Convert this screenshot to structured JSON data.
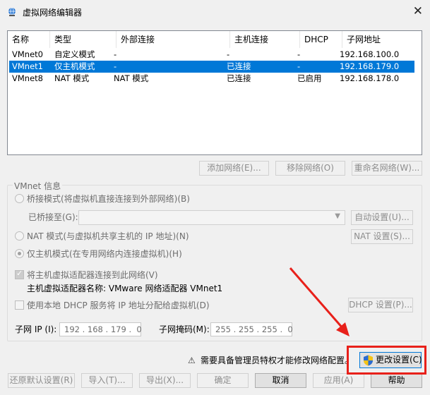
{
  "window": {
    "title": "虚拟网络编辑器",
    "close_glyph": "✕"
  },
  "network_list": {
    "columns": [
      "名称",
      "类型",
      "外部连接",
      "主机连接",
      "DHCP",
      "子网地址"
    ],
    "rows": [
      {
        "name": "VMnet0",
        "type": "自定义模式",
        "external": "-",
        "host": "-",
        "dhcp": "-",
        "subnet": "192.168.100.0",
        "selected": false
      },
      {
        "name": "VMnet1",
        "type": "仅主机模式",
        "external": "-",
        "host": "已连接",
        "dhcp": "-",
        "subnet": "192.168.179.0",
        "selected": true
      },
      {
        "name": "VMnet8",
        "type": "NAT 模式",
        "external": "NAT 模式",
        "host": "已连接",
        "dhcp": "已启用",
        "subnet": "192.168.178.0",
        "selected": false
      }
    ]
  },
  "list_buttons": {
    "add": "添加网络(E)...",
    "remove": "移除网络(O)",
    "rename": "重命名网络(W)..."
  },
  "vmnet_info": {
    "title": "VMnet 信息",
    "bridged_label": "桥接模式(将虚拟机直接连接到外部网络)(B)",
    "bridged_to_label": "已桥接至(G):",
    "bridged_to_value": "",
    "auto_settings_button": "自动设置(U)...",
    "nat_label": "NAT 模式(与虚拟机共享主机的 IP 地址)(N)",
    "nat_settings_button": "NAT 设置(S)...",
    "host_only_label": "仅主机模式(在专用网络内连接虚拟机)(H)",
    "selected_mode": "host_only",
    "connect_adapter_label": "将主机虚拟适配器连接到此网络(V)",
    "connect_adapter_checked": true,
    "adapter_name_label": "主机虚拟适配器名称: VMware 网络适配器 VMnet1",
    "use_dhcp_label": "使用本地 DHCP 服务将 IP 地址分配给虚拟机(D)",
    "use_dhcp_checked": false,
    "dhcp_settings_button": "DHCP 设置(P)...",
    "subnet_ip_label": "子网 IP (I):",
    "subnet_ip_value": "192 . 168 . 179 .  0",
    "subnet_mask_label": "子网掩码(M):",
    "subnet_mask_value": "255 . 255 . 255 .  0"
  },
  "admin_notice": {
    "warning_glyph": "⚠",
    "text": "需要具备管理员特权才能修改网络配置。",
    "change_settings_button": "更改设置(C)"
  },
  "footer_buttons": {
    "restore_defaults": "还原默认设置(R)",
    "import": "导入(T)...",
    "export": "导出(X)...",
    "ok": "确定",
    "cancel": "取消",
    "apply": "应用(A)",
    "help": "帮助"
  },
  "colors": {
    "selection": "#0078d7",
    "annotation_red": "#e8201a",
    "disabled_text": "#8d8d8d"
  }
}
